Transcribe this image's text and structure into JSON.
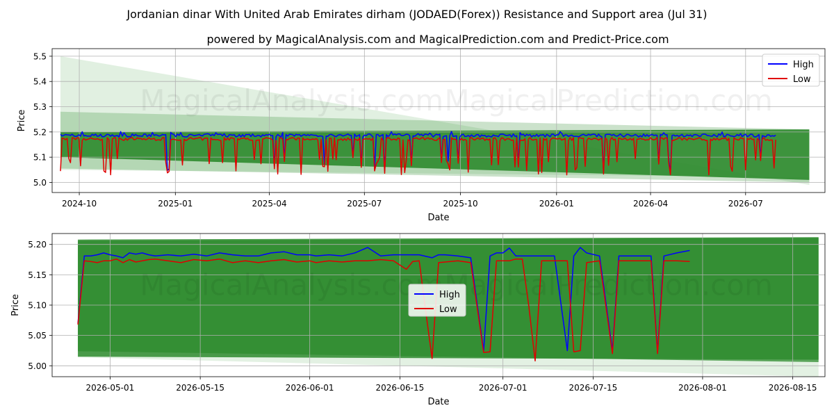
{
  "title": "Jordanian dinar With United Arab Emirates dirham (JODAED(Forex)) Resistance and Support area (Jul 31)",
  "subtitle": "powered by MagicalAnalysis.com and MagicalPrediction.com and Predict-Price.com",
  "watermarks": [
    "MagicalAnalysis.com",
    "MagicalPrediction.com"
  ],
  "colors": {
    "high": "#0000ff",
    "low": "#e00000",
    "band_dark": "#2e8b2e",
    "band_light": "#c8e3c8"
  },
  "chart_data": [
    {
      "type": "line",
      "xlabel": "Date",
      "ylabel": "Price",
      "grid": true,
      "legend": "top-right",
      "xlim": [
        "2024-09-05",
        "2026-09-15"
      ],
      "ylim": [
        4.96,
        5.53
      ],
      "xticks": [
        "2024-10",
        "2025-01",
        "2025-04",
        "2025-07",
        "2025-10",
        "2026-01",
        "2026-04",
        "2026-07"
      ],
      "yticks": [
        "5.0",
        "5.1",
        "5.2",
        "5.3",
        "5.4",
        "5.5"
      ],
      "series": [
        {
          "name": "High",
          "base": 5.186
        },
        {
          "name": "Low",
          "base": 5.172
        }
      ],
      "x_start": "2024-09-13",
      "x_end": "2026-07-31",
      "bands": [
        {
          "x": [
            "2024-09-13",
            "2026-08-31"
          ],
          "upper": [
            5.5,
            4.99
          ],
          "lower": [
            5.05,
            5.02
          ]
        },
        {
          "x": [
            "2024-09-13",
            "2026-08-31"
          ],
          "upper": [
            5.28,
            5.21
          ],
          "lower": [
            5.055,
            5.0
          ]
        },
        {
          "x": [
            "2024-09-13",
            "2026-08-31"
          ],
          "upper": [
            5.2,
            5.21
          ],
          "lower": [
            5.1,
            5.01
          ]
        }
      ]
    },
    {
      "type": "line",
      "xlabel": "Date",
      "ylabel": "Price",
      "grid": true,
      "legend": "center",
      "xlim": [
        "2026-04-22",
        "2026-08-20"
      ],
      "ylim": [
        4.982,
        5.218
      ],
      "xticks": [
        "2026-05-01",
        "2026-05-15",
        "2026-06-01",
        "2026-06-15",
        "2026-07-01",
        "2026-07-15",
        "2026-08-01",
        "2026-08-15"
      ],
      "yticks": [
        "5.00",
        "5.05",
        "5.10",
        "5.15",
        "5.20"
      ],
      "series": [
        {
          "name": "High",
          "dates": [
            "2026-04-26",
            "2026-04-27",
            "2026-04-28",
            "2026-04-29",
            "2026-04-30",
            "2026-05-01",
            "2026-05-02",
            "2026-05-03",
            "2026-05-04",
            "2026-05-05",
            "2026-05-06",
            "2026-05-07",
            "2026-05-08",
            "2026-05-10",
            "2026-05-12",
            "2026-05-14",
            "2026-05-16",
            "2026-05-18",
            "2026-05-20",
            "2026-05-22",
            "2026-05-24",
            "2026-05-26",
            "2026-05-28",
            "2026-05-30",
            "2026-06-01",
            "2026-06-02",
            "2026-06-04",
            "2026-06-06",
            "2026-06-08",
            "2026-06-10",
            "2026-06-12",
            "2026-06-14",
            "2026-06-16",
            "2026-06-18",
            "2026-06-20",
            "2026-06-21",
            "2026-06-22",
            "2026-06-24",
            "2026-06-26",
            "2026-06-28",
            "2026-06-29",
            "2026-06-30",
            "2026-07-01",
            "2026-07-02",
            "2026-07-03",
            "2026-07-04",
            "2026-07-06",
            "2026-07-07",
            "2026-07-09",
            "2026-07-11",
            "2026-07-12",
            "2026-07-13",
            "2026-07-14",
            "2026-07-16",
            "2026-07-18",
            "2026-07-19",
            "2026-07-20",
            "2026-07-22",
            "2026-07-23",
            "2026-07-24",
            "2026-07-25",
            "2026-07-26",
            "2026-07-28",
            "2026-07-30"
          ],
          "values": [
            5.07,
            5.181,
            5.181,
            5.183,
            5.186,
            5.183,
            5.181,
            5.178,
            5.186,
            5.184,
            5.186,
            5.183,
            5.181,
            5.183,
            5.181,
            5.184,
            5.181,
            5.186,
            5.183,
            5.181,
            5.181,
            5.186,
            5.188,
            5.183,
            5.183,
            5.181,
            5.183,
            5.181,
            5.186,
            5.195,
            5.181,
            5.183,
            5.183,
            5.183,
            5.178,
            5.183,
            5.183,
            5.181,
            5.178,
            5.025,
            5.181,
            5.186,
            5.186,
            5.194,
            5.181,
            5.181,
            5.181,
            5.181,
            5.181,
            5.025,
            5.181,
            5.195,
            5.186,
            5.181,
            5.025,
            5.181,
            5.181,
            5.181,
            5.181,
            5.181,
            5.023,
            5.181,
            5.186,
            5.19
          ]
        },
        {
          "name": "Low",
          "dates": [
            "2026-04-26",
            "2026-04-27",
            "2026-04-28",
            "2026-04-29",
            "2026-04-30",
            "2026-05-01",
            "2026-05-02",
            "2026-05-03",
            "2026-05-04",
            "2026-05-05",
            "2026-05-06",
            "2026-05-07",
            "2026-05-08",
            "2026-05-10",
            "2026-05-12",
            "2026-05-14",
            "2026-05-16",
            "2026-05-18",
            "2026-05-20",
            "2026-05-22",
            "2026-05-24",
            "2026-05-26",
            "2026-05-28",
            "2026-05-30",
            "2026-06-01",
            "2026-06-02",
            "2026-06-04",
            "2026-06-06",
            "2026-06-08",
            "2026-06-10",
            "2026-06-12",
            "2026-06-14",
            "2026-06-16",
            "2026-06-17",
            "2026-06-18",
            "2026-06-19",
            "2026-06-20",
            "2026-06-21",
            "2026-06-22",
            "2026-06-24",
            "2026-06-26",
            "2026-06-28",
            "2026-06-29",
            "2026-06-30",
            "2026-07-01",
            "2026-07-02",
            "2026-07-03",
            "2026-07-04",
            "2026-07-05",
            "2026-07-06",
            "2026-07-07",
            "2026-07-09",
            "2026-07-11",
            "2026-07-12",
            "2026-07-13",
            "2026-07-14",
            "2026-07-16",
            "2026-07-18",
            "2026-07-19",
            "2026-07-20",
            "2026-07-22",
            "2026-07-23",
            "2026-07-24",
            "2026-07-25",
            "2026-07-26",
            "2026-07-28",
            "2026-07-30"
          ],
          "values": [
            5.068,
            5.173,
            5.172,
            5.17,
            5.173,
            5.173,
            5.176,
            5.17,
            5.175,
            5.171,
            5.173,
            5.175,
            5.176,
            5.173,
            5.17,
            5.175,
            5.173,
            5.176,
            5.17,
            5.173,
            5.17,
            5.173,
            5.175,
            5.171,
            5.173,
            5.17,
            5.173,
            5.171,
            5.173,
            5.173,
            5.175,
            5.173,
            5.159,
            5.172,
            5.173,
            5.09,
            5.012,
            5.17,
            5.171,
            5.173,
            5.17,
            5.022,
            5.023,
            5.173,
            5.173,
            5.173,
            5.176,
            5.176,
            5.1,
            5.008,
            5.173,
            5.173,
            5.173,
            5.023,
            5.025,
            5.17,
            5.173,
            5.02,
            5.173,
            5.173,
            5.173,
            5.173,
            5.173,
            5.02,
            5.173,
            5.173,
            5.172
          ]
        }
      ],
      "bands": [
        {
          "x": [
            "2026-04-26",
            "2026-08-19"
          ],
          "upper": [
            5.205,
            5.21
          ],
          "lower": [
            5.014,
            4.982
          ]
        },
        {
          "x": [
            "2026-04-26",
            "2026-08-19"
          ],
          "upper": [
            5.206,
            5.211
          ],
          "lower": [
            5.024,
            5.006
          ]
        },
        {
          "x": [
            "2026-04-26",
            "2026-08-19"
          ],
          "upper": [
            5.208,
            5.212
          ],
          "lower": [
            5.015,
            5.01
          ]
        }
      ]
    }
  ]
}
